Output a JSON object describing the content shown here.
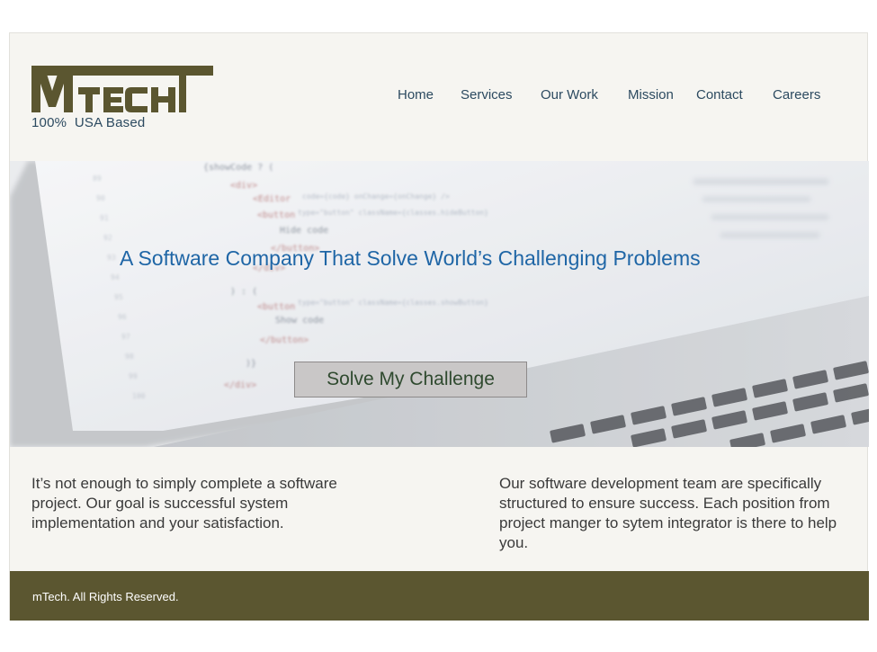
{
  "brand": {
    "logo_text": "MTECH",
    "tagline": "100%  USA Based",
    "color": "#5b5630"
  },
  "nav": {
    "items": [
      {
        "label": "Home"
      },
      {
        "label": "Services"
      },
      {
        "label": "Our Work"
      },
      {
        "label": "Mission"
      },
      {
        "label": "Contact"
      },
      {
        "label": "Careers"
      }
    ],
    "color": "#2c4a60"
  },
  "hero": {
    "title": "A Software Company That Solve World’s Challenging Problems",
    "cta_label": "Solve My Challenge",
    "title_color": "#1f66a6"
  },
  "content": {
    "left": "It’s not enough to simply complete a software project. Our goal is successful system implementation and your satisfaction.",
    "right": "Our software development team are specifically structured to ensure success. Each position from project manger to sytem integrator is there to help you."
  },
  "footer": {
    "text": "mTech. All Rights Reserved.",
    "background": "#5b5630"
  }
}
